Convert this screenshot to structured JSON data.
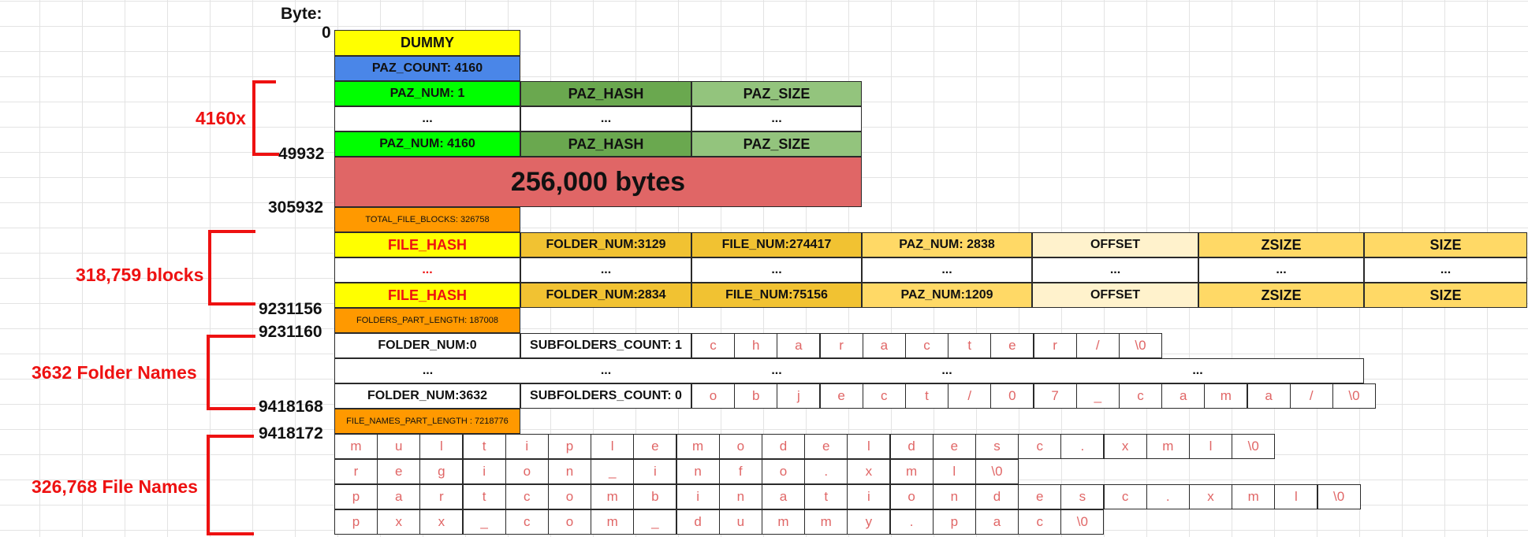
{
  "byte_header": "Byte:",
  "offsets": [
    "0",
    "49932",
    "305932",
    "9231156",
    "9231160",
    "9418168",
    "9418172"
  ],
  "brackets": [
    "4160x",
    "318,759 blocks",
    "3632 Folder Names",
    "326,768 File Names"
  ],
  "header": {
    "dummy": "DUMMY",
    "paz_count": "PAZ_COUNT: 4160"
  },
  "paz_rows": [
    [
      "PAZ_NUM: 1",
      "PAZ_HASH",
      "PAZ_SIZE"
    ],
    [
      "...",
      "...",
      "..."
    ],
    [
      "PAZ_NUM: 4160",
      "PAZ_HASH",
      "PAZ_SIZE"
    ]
  ],
  "big_block": "256,000 bytes",
  "total_file_blocks": "TOTAL_FILE_BLOCKS: 326758",
  "file_rows": [
    [
      "FILE_HASH",
      "FOLDER_NUM:3129",
      "FILE_NUM:274417",
      "PAZ_NUM: 2838",
      "OFFSET",
      "ZSIZE",
      "SIZE"
    ],
    [
      "...",
      "...",
      "...",
      "...",
      "...",
      "...",
      "..."
    ],
    [
      "FILE_HASH",
      "FOLDER_NUM:2834",
      "FILE_NUM:75156",
      "PAZ_NUM:1209",
      "OFFSET",
      "ZSIZE",
      "SIZE"
    ]
  ],
  "folders_part_length": "FOLDERS_PART_LENGTH: 187008",
  "folder_rows": [
    {
      "num": "FOLDER_NUM:0",
      "sub": "SUBFOLDERS_COUNT: 1",
      "chars": [
        "c",
        "h",
        "a",
        "r",
        "a",
        "c",
        "t",
        "e",
        "r",
        "/",
        "\\0"
      ]
    },
    {
      "num": "...",
      "sub": "...",
      "dots": [
        "...",
        "...",
        "..."
      ]
    },
    {
      "num": "FOLDER_NUM:3632",
      "sub": "SUBFOLDERS_COUNT: 0",
      "chars": [
        "o",
        "b",
        "j",
        "e",
        "c",
        "t",
        "/",
        "0",
        "7",
        "_",
        "c",
        "a",
        "m",
        "a",
        "/",
        "\\0"
      ]
    }
  ],
  "file_names_part_length": "FILE_NAMES_PART_LENGTH : 7218776",
  "file_name_rows": [
    [
      "m",
      "u",
      "l",
      "t",
      "i",
      "p",
      "l",
      "e",
      "m",
      "o",
      "d",
      "e",
      "l",
      "d",
      "e",
      "s",
      "c",
      ".",
      "x",
      "m",
      "l",
      "\\0"
    ],
    [
      "r",
      "e",
      "g",
      "i",
      "o",
      "n",
      "_",
      "i",
      "n",
      "f",
      "o",
      ".",
      "x",
      "m",
      "l",
      "\\0"
    ],
    [
      "p",
      "a",
      "r",
      "t",
      "c",
      "o",
      "m",
      "b",
      "i",
      "n",
      "a",
      "t",
      "i",
      "o",
      "n",
      "d",
      "e",
      "s",
      "c",
      ".",
      "x",
      "m",
      "l",
      "\\0"
    ],
    [
      "p",
      "x",
      "x",
      "_",
      "c",
      "o",
      "m",
      "_",
      "d",
      "u",
      "m",
      "m",
      "y",
      ".",
      "p",
      "a",
      "c",
      "\\0"
    ]
  ],
  "colors": {
    "yellow": "#ffff00",
    "blue": "#4a86e8",
    "green": "#00ff00",
    "green_dark": "#6aa84f",
    "green_light": "#93c47d",
    "red_block": "#e06666",
    "orange": "#ff9900",
    "gold": "#f1c232",
    "gold_light": "#ffd966",
    "cream": "#fff2cc",
    "bracket_red": "#ee1111"
  }
}
